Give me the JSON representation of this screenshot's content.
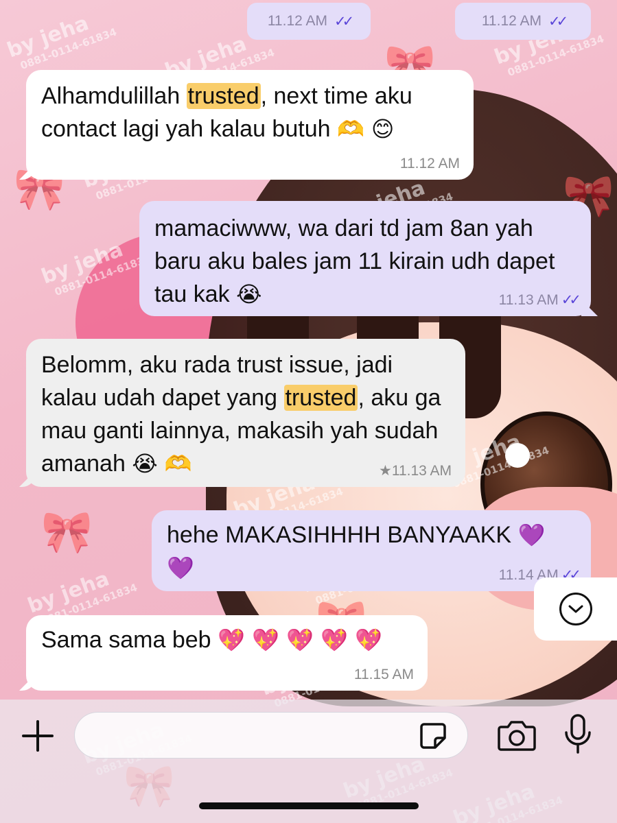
{
  "top_receipts": [
    {
      "time": "11.12 AM",
      "ticks": "✓✓"
    },
    {
      "time": "11.12 AM",
      "ticks": "✓✓"
    }
  ],
  "messages": [
    {
      "direction": "incoming",
      "before": "Alhamdulillah ",
      "highlight": "trusted",
      "after": ", next time aku contact lagi yah kalau butuh",
      "emoji": "🫶 😊",
      "time": "11.12 AM"
    },
    {
      "direction": "outgoing",
      "text": "mamaciwww, wa dari td jam 8an yah baru aku bales jam 11 kirain udh dapet tau kak",
      "emoji": "😭",
      "time": "11.13 AM",
      "ticks": "✓✓"
    },
    {
      "direction": "incoming",
      "before": "Belomm, aku rada trust issue, jadi kalau udah dapet yang ",
      "highlight": "trusted",
      "after": ", aku ga mau ganti lainnya, makasih yah sudah amanah",
      "emoji": "😭 🫶",
      "star": "★",
      "time": "11.13 AM"
    },
    {
      "direction": "outgoing",
      "text": "hehe MAKASIHHHH BANYAAKK",
      "emoji": "💜 💜",
      "time": "11.14 AM",
      "ticks": "✓✓"
    },
    {
      "direction": "incoming",
      "text": "Sama sama beb",
      "emoji": "💖 💖 💖 💖 💖",
      "time": "11.15 AM"
    }
  ],
  "wallpaper": {
    "watermark_name": "by jeha",
    "watermark_phone": "0881-0114-61834"
  },
  "composer": {
    "plus_icon": "plus-icon",
    "sticker_icon": "sticker-icon",
    "camera_icon": "camera-icon",
    "mic_icon": "microphone-icon"
  },
  "colors": {
    "incoming_bubble": "#ffffff",
    "outgoing_bubble": "#e4ddf9",
    "read_ticks": "#5b46d8",
    "highlight": "#f9cd6a",
    "wallpaper": "#f3b9c9"
  }
}
